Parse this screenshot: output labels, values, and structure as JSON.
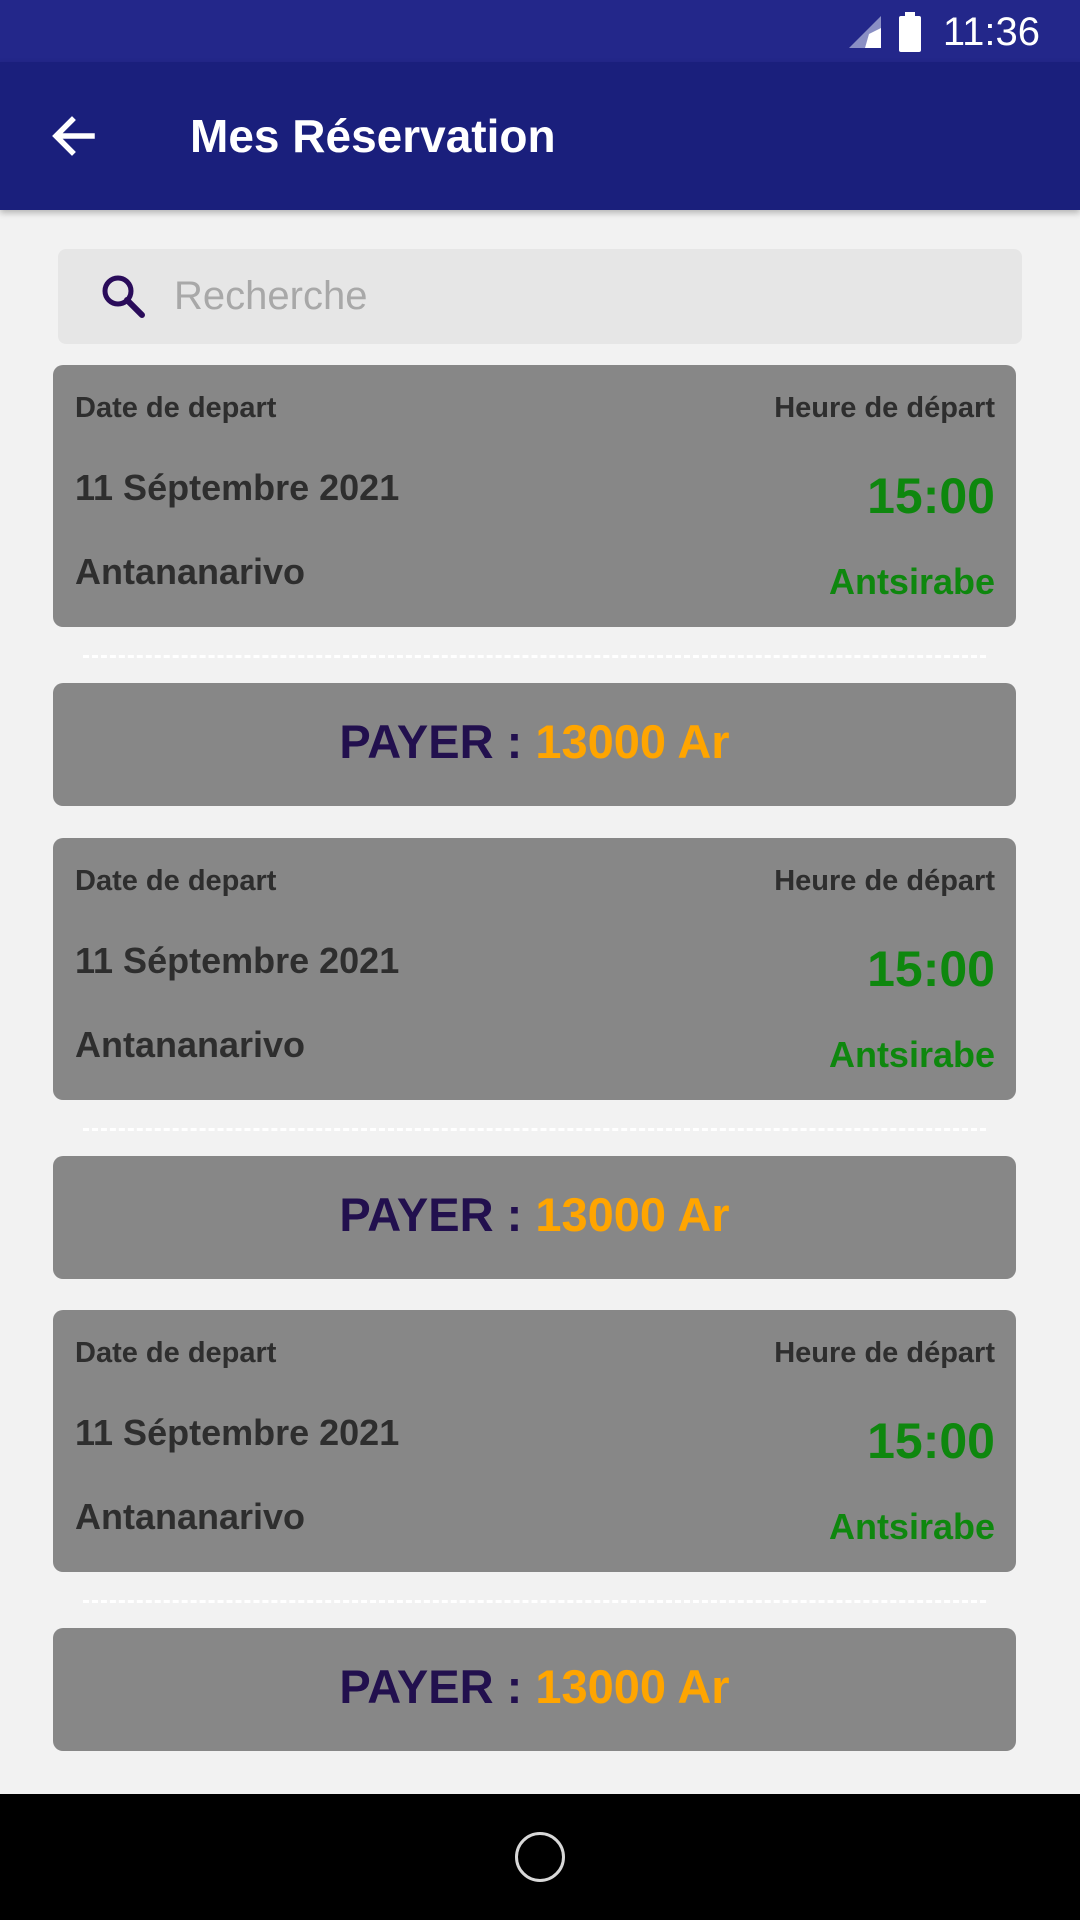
{
  "status_bar": {
    "time": "11:36"
  },
  "app_bar": {
    "title": "Mes Réservation"
  },
  "search": {
    "placeholder": "Recherche",
    "value": ""
  },
  "reservations": [
    {
      "depart_label": "Date de depart",
      "time_label": "Heure de départ",
      "date": "11 Séptembre 2021",
      "time": "15:00",
      "origin": "Antananarivo",
      "destination": "Antsirabe",
      "pay_label": "PAYER :",
      "amount": "13000 Ar"
    },
    {
      "depart_label": "Date de depart",
      "time_label": "Heure de départ",
      "date": "11 Séptembre 2021",
      "time": "15:00",
      "origin": "Antananarivo",
      "destination": "Antsirabe",
      "pay_label": "PAYER :",
      "amount": "13000 Ar"
    },
    {
      "depart_label": "Date de depart",
      "time_label": "Heure de départ",
      "date": "11 Séptembre 2021",
      "time": "15:00",
      "origin": "Antananarivo",
      "destination": "Antsirabe",
      "pay_label": "PAYER :",
      "amount": "13000 Ar"
    }
  ],
  "colors": {
    "app_bar": "#1a1f7c",
    "status_bar": "#23278a",
    "card": "#878787",
    "time_green": "#0e870e",
    "amount_orange": "#ffa500",
    "pay_label": "#22104e"
  },
  "icons": {
    "signal": "signal-icon",
    "battery": "battery-icon",
    "back": "arrow-back-icon",
    "search": "search-icon",
    "home": "home-circle-icon"
  }
}
